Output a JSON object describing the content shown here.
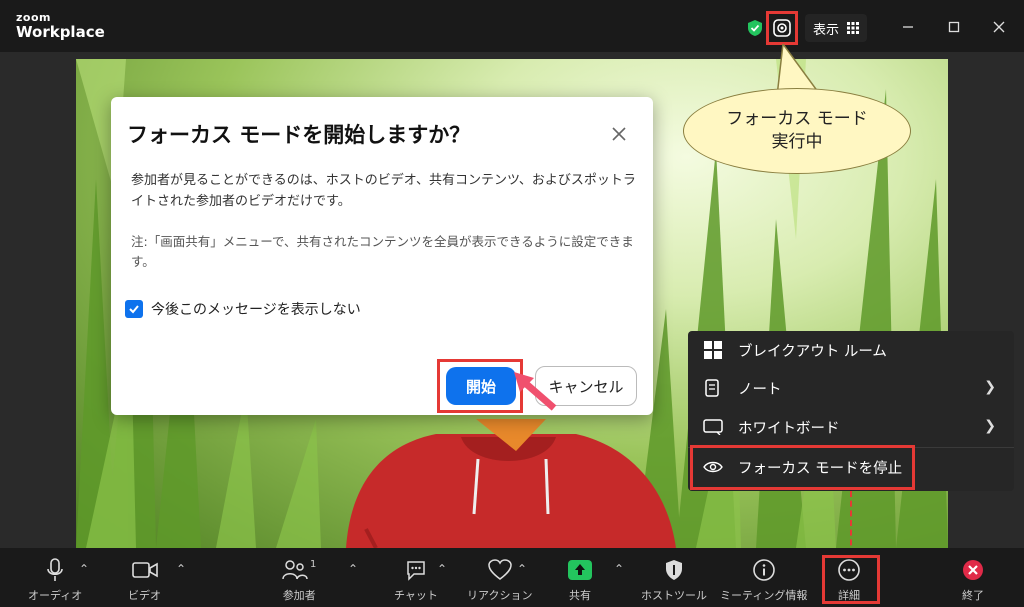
{
  "app": {
    "logo_top": "zoom",
    "logo_bottom": "Workplace"
  },
  "header": {
    "view_label": "表示"
  },
  "callout": {
    "line1": "フォーカス モード",
    "line2": "実行中"
  },
  "dialog": {
    "title": "フォーカス モードを開始しますか？",
    "body": "参加者が見ることができるのは、ホストのビデオ、共有コンテンツ、およびスポットライトされた参加者のビデオだけです。",
    "note": "注:「画面共有」メニューで、共有されたコンテンツを全員が表示できるように設定できます。",
    "checkbox_label": "今後このメッセージを表示しない",
    "checkbox_checked": true,
    "start_label": "開始",
    "cancel_label": "キャンセル"
  },
  "menu": {
    "items": [
      {
        "label": "ブレイクアウト ルーム",
        "icon": "grid-icon"
      },
      {
        "label": "ノート",
        "icon": "note-icon",
        "submenu": true
      },
      {
        "label": "ホワイトボード",
        "icon": "whiteboard-icon",
        "submenu": true
      },
      {
        "label": "フォーカス モードを停止",
        "icon": "eye-icon"
      }
    ]
  },
  "toolbar": {
    "audio": "オーディオ",
    "video": "ビデオ",
    "participants": "参加者",
    "participants_count": "1",
    "chat": "チャット",
    "reactions": "リアクション",
    "share": "共有",
    "host_tools": "ホストツール",
    "meeting_info": "ミーティング情報",
    "more": "詳細",
    "end": "終了"
  },
  "colors": {
    "accent": "#0e72ed",
    "highlight": "#e53935",
    "share_green": "#23c45e",
    "callout_bg": "#fff7c2"
  }
}
